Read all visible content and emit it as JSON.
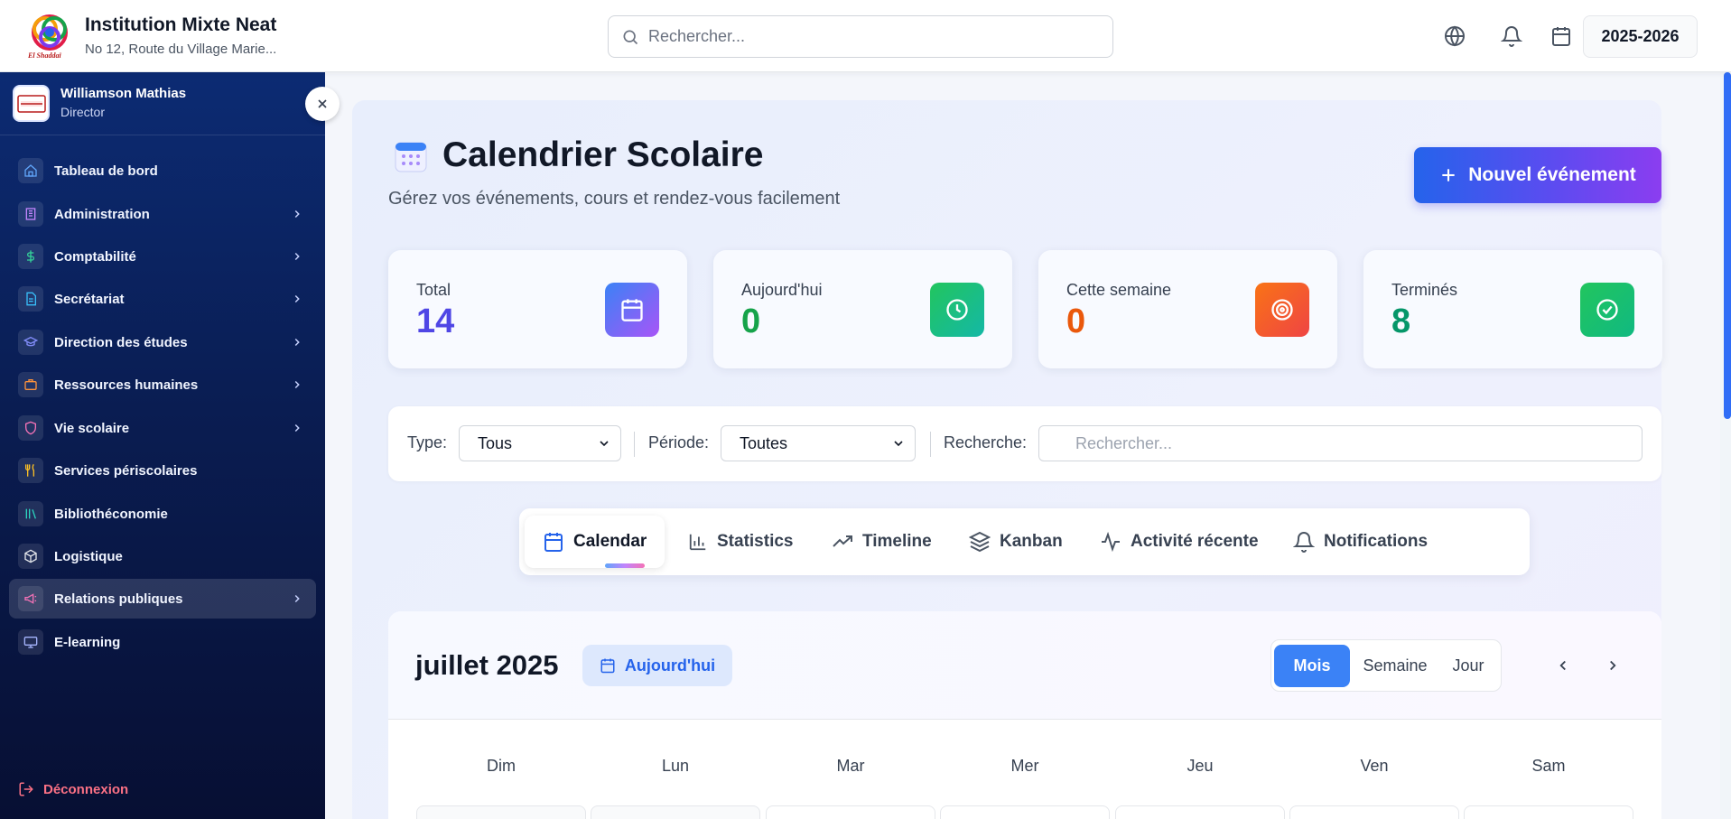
{
  "header": {
    "institution_name": "Institution Mixte Neat",
    "institution_address": "No 12, Route du Village Marie...",
    "logo_text": "El Shaddaï",
    "search_placeholder": "Rechercher...",
    "school_year": "2025-2026",
    "icons": [
      "globe-icon",
      "bell-icon",
      "calendar-icon"
    ]
  },
  "sidebar": {
    "user": {
      "name": "Williamson Mathias",
      "role": "Director"
    },
    "items": [
      {
        "label": "Tableau de bord",
        "icon": "home-icon",
        "color": "#60a5fa",
        "has_children": false
      },
      {
        "label": "Administration",
        "icon": "building-icon",
        "color": "#c084fc",
        "has_children": true
      },
      {
        "label": "Comptabilité",
        "icon": "dollar-icon",
        "color": "#34d399",
        "has_children": true
      },
      {
        "label": "Secrétariat",
        "icon": "document-icon",
        "color": "#38bdf8",
        "has_children": true
      },
      {
        "label": "Direction des études",
        "icon": "graduation-cap-icon",
        "color": "#818cf8",
        "has_children": true
      },
      {
        "label": "Ressources humaines",
        "icon": "briefcase-icon",
        "color": "#fb923c",
        "has_children": true
      },
      {
        "label": "Vie scolaire",
        "icon": "shield-icon",
        "color": "#f472b6",
        "has_children": true
      },
      {
        "label": "Services périscolaires",
        "icon": "utensils-icon",
        "color": "#fbbf24",
        "has_children": false
      },
      {
        "label": "Bibliothéconomie",
        "icon": "library-icon",
        "color": "#2dd4bf",
        "has_children": false
      },
      {
        "label": "Logistique",
        "icon": "package-icon",
        "color": "#e5e7eb",
        "has_children": false
      },
      {
        "label": "Relations publiques",
        "icon": "megaphone-icon",
        "color": "#f472b6",
        "has_children": true,
        "active": true
      },
      {
        "label": "E-learning",
        "icon": "monitor-icon",
        "color": "#a5b4fc",
        "has_children": false
      }
    ],
    "logout_label": "Déconnexion"
  },
  "page": {
    "title": "Calendrier Scolaire",
    "subtitle": "Gérez vos événements, cours et rendez-vous facilement",
    "new_event_label": "Nouvel événement"
  },
  "stats": [
    {
      "label": "Total",
      "value": "14",
      "color": "#4f46e5",
      "icon": "calendar-icon"
    },
    {
      "label": "Aujourd'hui",
      "value": "0",
      "color": "#16a34a",
      "icon": "clock-icon"
    },
    {
      "label": "Cette semaine",
      "value": "0",
      "color": "#ea580c",
      "icon": "target-icon"
    },
    {
      "label": "Terminés",
      "value": "8",
      "color": "#059669",
      "icon": "check-circle-icon"
    }
  ],
  "filters": {
    "type_label": "Type:",
    "type_value": "Tous",
    "period_label": "Période:",
    "period_value": "Toutes",
    "search_label": "Recherche:",
    "search_placeholder": "Rechercher..."
  },
  "tabs": [
    {
      "label": "Calendar",
      "icon": "calendar-icon",
      "active": true
    },
    {
      "label": "Statistics",
      "icon": "bar-chart-icon"
    },
    {
      "label": "Timeline",
      "icon": "trending-up-icon"
    },
    {
      "label": "Kanban",
      "icon": "layers-icon"
    },
    {
      "label": "Activité récente",
      "icon": "activity-icon"
    },
    {
      "label": "Notifications",
      "icon": "bell-icon"
    }
  ],
  "calendar": {
    "month_title": "juillet 2025",
    "today_label": "Aujourd'hui",
    "views": [
      {
        "label": "Mois",
        "active": true
      },
      {
        "label": "Semaine"
      },
      {
        "label": "Jour"
      }
    ],
    "weekdays": [
      "Dim",
      "Lun",
      "Mar",
      "Mer",
      "Jeu",
      "Ven",
      "Sam"
    ]
  },
  "colors": {
    "primary": "#2563eb",
    "sidebar_bg": "#0c2b73",
    "accent_purple": "#8b3df0"
  }
}
